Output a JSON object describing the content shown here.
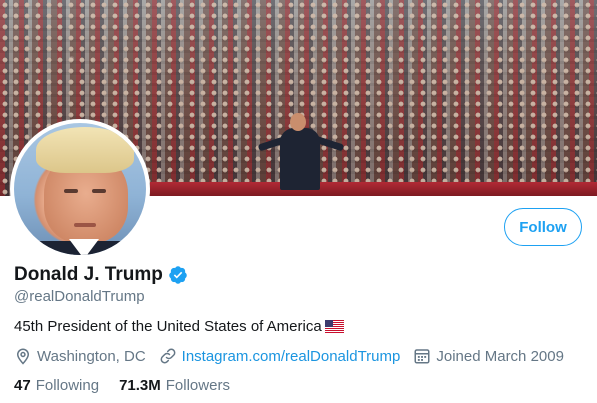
{
  "profile": {
    "display_name": "Donald J. Trump",
    "handle": "@realDonaldTrump",
    "bio": "45th President of the United States of America",
    "bio_emoji_icon": "us-flag-icon",
    "verified": true,
    "verified_icon": "verified-badge-icon"
  },
  "actions": {
    "follow_label": "Follow"
  },
  "meta": {
    "location": "Washington, DC",
    "location_icon": "location-pin-icon",
    "website": "Instagram.com/realDonaldTrump",
    "website_icon": "link-icon",
    "joined": "Joined March 2009",
    "joined_icon": "calendar-icon"
  },
  "stats": {
    "following_count": "47",
    "following_label": "Following",
    "followers_count": "71.3M",
    "followers_label": "Followers"
  },
  "images": {
    "banner": "rally-crowd-banner-photo",
    "avatar": "profile-avatar-photo"
  },
  "colors": {
    "accent": "#1da1f2",
    "link": "#1b95e0",
    "muted": "#657786",
    "text": "#14171a"
  }
}
